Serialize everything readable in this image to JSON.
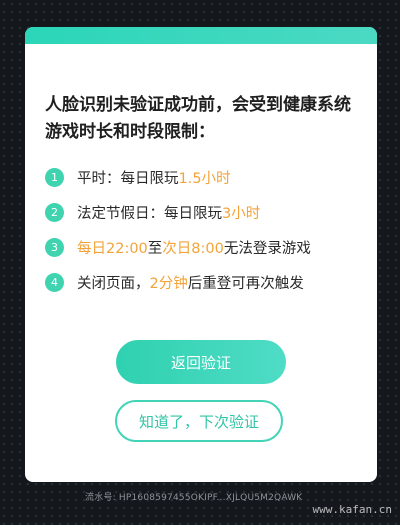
{
  "dialog": {
    "notice": "人脸识别未验证成功前，会受到健康系统游戏时长和时段限制：",
    "rules": [
      {
        "num": "1",
        "parts": [
          "平时：每日限玩 ",
          "1.5小时",
          ""
        ]
      },
      {
        "num": "2",
        "parts": [
          "法定节假日：每日限玩 ",
          "3小时",
          ""
        ]
      },
      {
        "num": "3",
        "parts": [
          "",
          "每日22:00",
          "至",
          "次日8:00",
          " 无法登录游戏"
        ]
      },
      {
        "num": "4",
        "parts": [
          "关闭页面，",
          "2分钟",
          "后重登可再次触发"
        ]
      }
    ],
    "primary_button": "返回验证",
    "secondary_button": "知道了，下次验证"
  },
  "serial": "流水号: HP1608597455OKIPF...XJLQU5M2QAWK",
  "watermark": {
    "logo_text": "卡饭网",
    "url": "www.kafan.cn"
  },
  "colors": {
    "accent": "#3fd3b0",
    "highlight": "#f3a33a"
  }
}
